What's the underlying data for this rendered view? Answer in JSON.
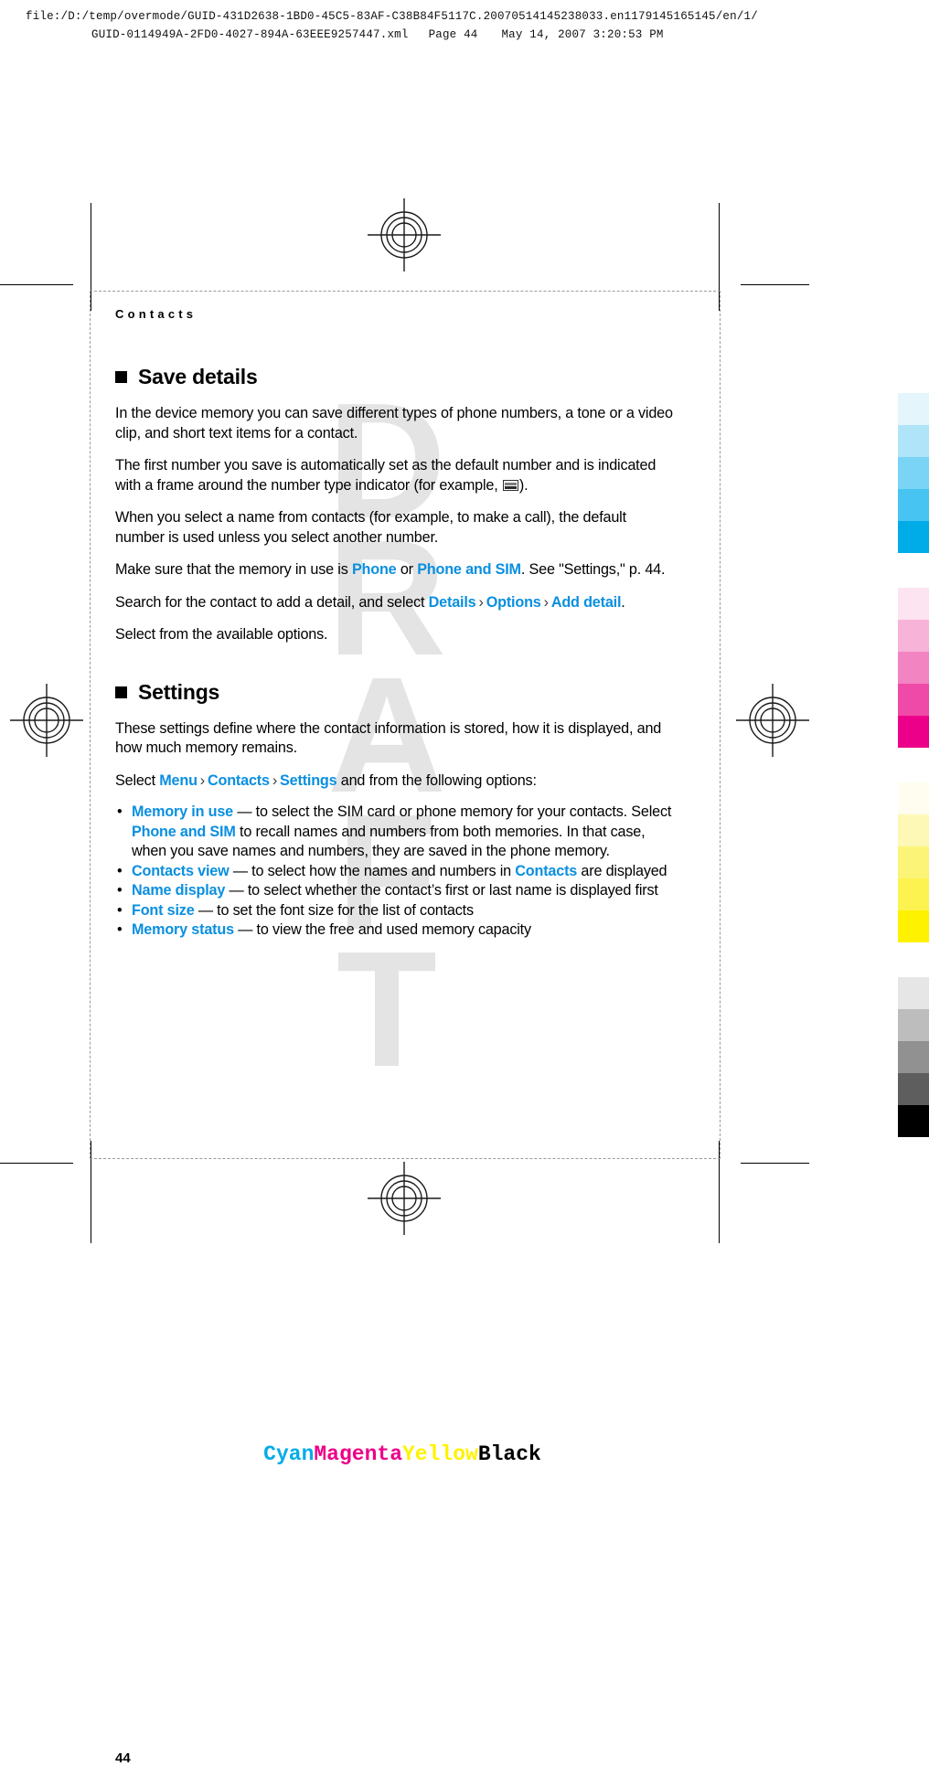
{
  "print_header": {
    "line1": "file:/D:/temp/overmode/GUID-431D2638-1BD0-45C5-83AF-C38B84F5117C.20070514145238033.en1179145165145/en/1/",
    "line2_file": "GUID-0114949A-2FD0-4027-894A-63EEE9257447.xml",
    "line2_page": "Page 44",
    "line2_date": "May 14, 2007 3:20:53 PM"
  },
  "page": {
    "running_head": "Contacts",
    "page_number": "44",
    "watermark": "DRAFT"
  },
  "sections": {
    "save_details": {
      "heading": "Save details",
      "p1": "In the device memory you can save different types of phone numbers, a tone or a video clip, and short text items for a contact.",
      "p2_a": "The first number you save is automatically set as the default number and is indicated with a frame around the number type indicator (for example, ",
      "p2_b": ").",
      "p3": "When you select a name from contacts (for example, to make a call), the default number is used unless you select another number.",
      "p4_a": "Make sure that the memory in use is ",
      "p4_link1": "Phone",
      "p4_mid": " or ",
      "p4_link2": "Phone and SIM",
      "p4_b": ". See \"Settings,\" p. 44.",
      "p5_a": "Search for the contact to add a detail, and select ",
      "p5_link1": "Details",
      "p5_link2": "Options",
      "p5_link3": "Add detail",
      "p5_b": ".",
      "p6": "Select from the available options."
    },
    "settings": {
      "heading": "Settings",
      "p1": "These settings define where the contact information is stored, how it is displayed, and how much memory remains.",
      "select_prefix": "Select ",
      "select_link1": "Menu",
      "select_link2": "Contacts",
      "select_link3": "Settings",
      "select_suffix": " and from the following options:",
      "separator": "›",
      "options": [
        {
          "term": "Memory in use",
          "desc_a": "  — to select the SIM card or phone memory for your contacts. Select ",
          "inline_link": "Phone and SIM",
          "desc_b": " to recall names and numbers from both memories. In that case, when you save names and numbers, they are saved in the phone memory."
        },
        {
          "term": "Contacts view",
          "desc_a": "  — to select how the names and numbers in ",
          "inline_link": "Contacts",
          "desc_b": " are displayed"
        },
        {
          "term": "Name display",
          "desc_a": " —  to select whether the contact’s first or last name is displayed first",
          "inline_link": "",
          "desc_b": ""
        },
        {
          "term": "Font size",
          "desc_a": "  — to set the font size for the list of contacts",
          "inline_link": "",
          "desc_b": ""
        },
        {
          "term": "Memory status",
          "desc_a": " —  to view the free and used memory capacity",
          "inline_link": "",
          "desc_b": ""
        }
      ]
    }
  },
  "cmyk_legend": {
    "cyan": "Cyan",
    "magenta": "Magenta",
    "yellow": "Yellow",
    "black": "Black"
  },
  "colors": {
    "link_blue": "#0a8fe0",
    "cyan": "#00ace8",
    "magenta": "#ec0089",
    "yellow": "#fff200",
    "black": "#000000",
    "watermark_gray": "#e4e4e4"
  },
  "swatch_strip": {
    "cyan_ramp": [
      "#e4f5fc",
      "#b0e4f9",
      "#7ad4f6",
      "#47c4f2",
      "#00ace8"
    ],
    "magenta_ramp": [
      "#fce4f1",
      "#f7b3d8",
      "#f284c2",
      "#ef4aa7",
      "#ec0089"
    ],
    "yellow_ramp": [
      "#fffdef",
      "#fdf8b5",
      "#fcf477",
      "#fdf350",
      "#fff200"
    ],
    "black_ramp": [
      "#e6e6e6",
      "#bdbdbd",
      "#919191",
      "#5e5e5e",
      "#000000"
    ]
  }
}
